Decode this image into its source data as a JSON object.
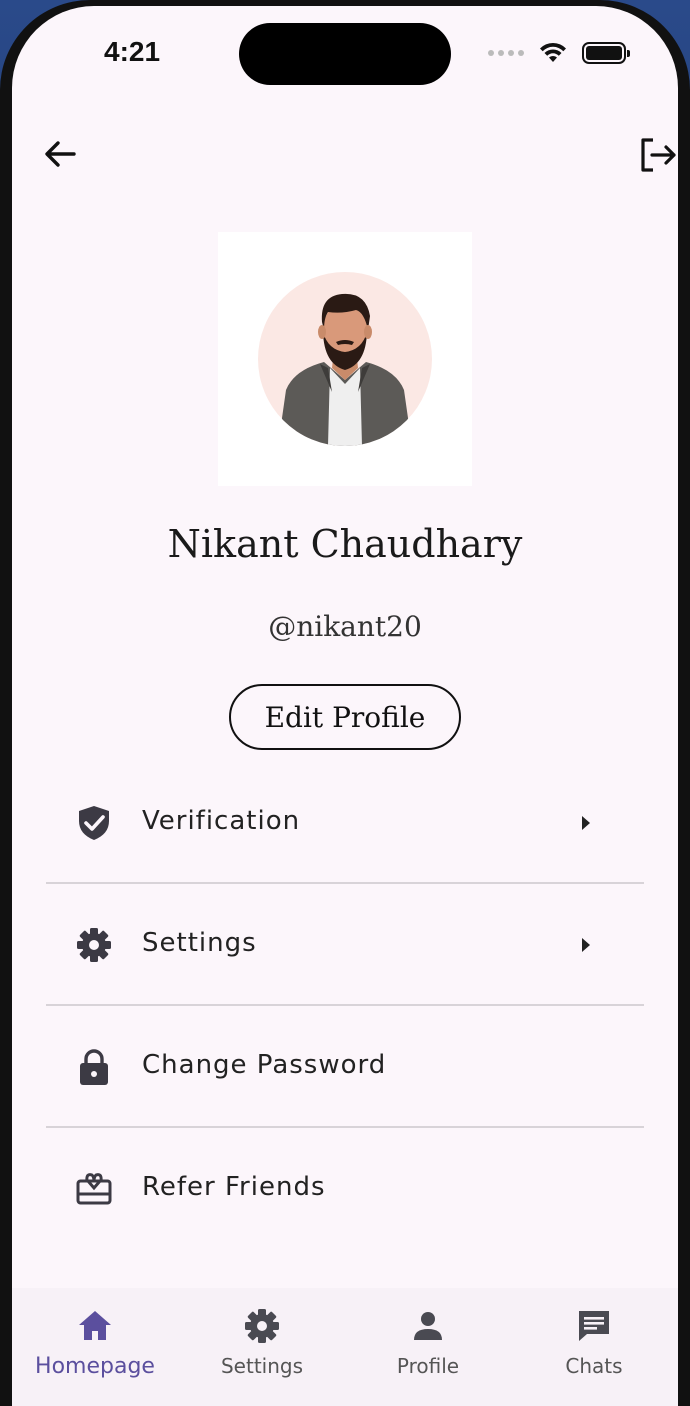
{
  "status_bar": {
    "time": "4:21"
  },
  "profile": {
    "name": "Nikant Chaudhary",
    "handle": "@nikant20",
    "edit_label": "Edit Profile"
  },
  "menu": [
    {
      "label": "Verification",
      "icon": "shield-check-icon",
      "has_arrow": true
    },
    {
      "label": "Settings",
      "icon": "gear-icon",
      "has_arrow": true
    },
    {
      "label": "Change Password",
      "icon": "lock-icon",
      "has_arrow": false
    },
    {
      "label": "Refer Friends",
      "icon": "gift-card-icon",
      "has_arrow": false
    }
  ],
  "bottom_nav": [
    {
      "label": "Homepage",
      "icon": "home-icon",
      "active": true
    },
    {
      "label": "Settings",
      "icon": "gear-icon",
      "active": false
    },
    {
      "label": "Profile",
      "icon": "person-icon",
      "active": false
    },
    {
      "label": "Chats",
      "icon": "chat-icon",
      "active": false
    }
  ],
  "colors": {
    "background": "#fcf6fb",
    "accent": "#5b4f9e",
    "avatar_bg": "#fbe8e4"
  }
}
